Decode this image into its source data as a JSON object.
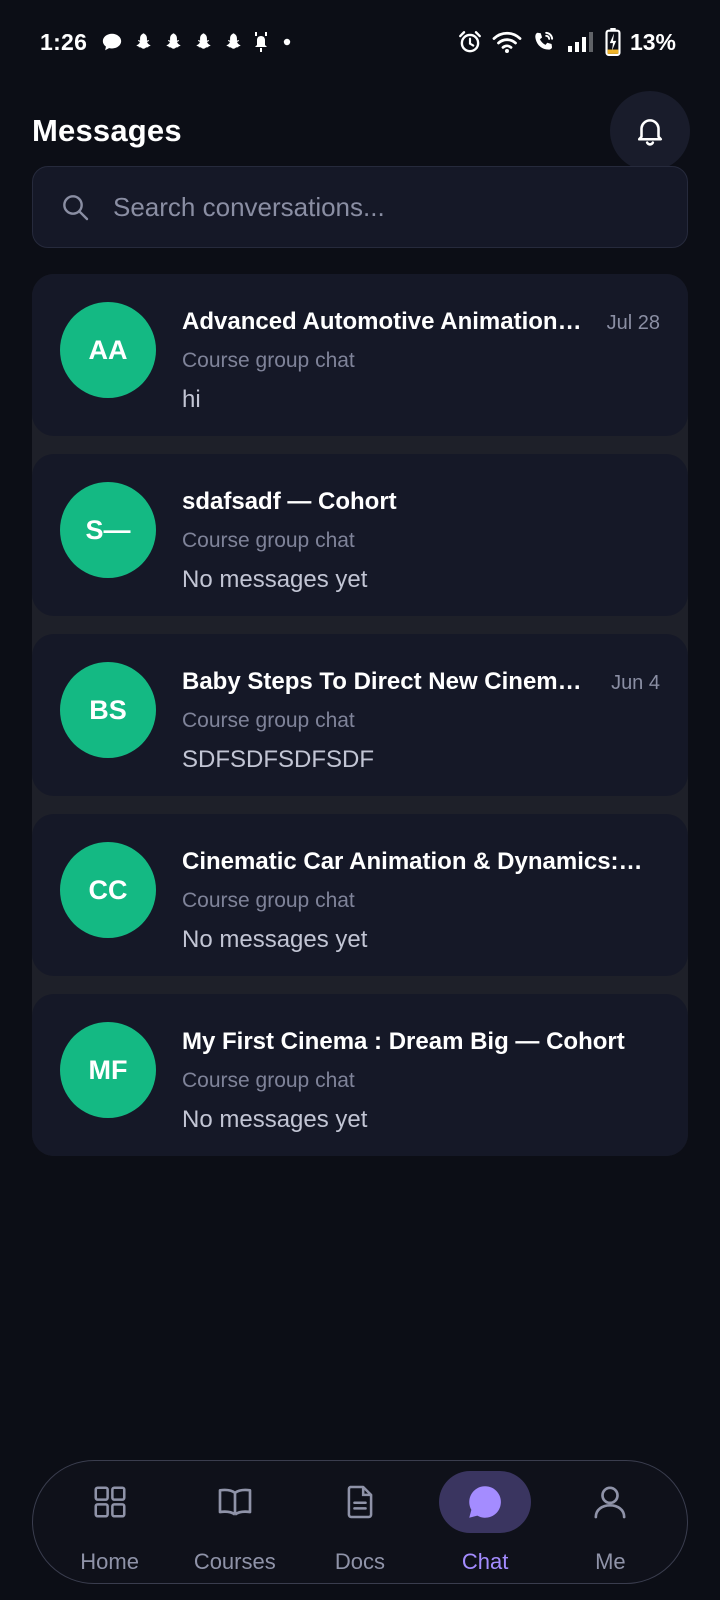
{
  "status_bar": {
    "time": "1:26",
    "battery": "13%",
    "notification_icons": [
      "chat-bubble-icon",
      "snapchat-icon",
      "snapchat-icon",
      "snapchat-icon",
      "snapchat-icon",
      "app-notification-icon",
      "dot-icon"
    ],
    "system_icons": [
      "alarm-icon",
      "wifi-icon",
      "wifi-calling-icon",
      "signal-icon",
      "battery-charging-icon"
    ]
  },
  "header": {
    "title": "Messages",
    "notification_icon": "bell-icon"
  },
  "search": {
    "placeholder": "Search conversations..."
  },
  "conversations": [
    {
      "initials": "AA",
      "title": "Advanced Automotive Animation…",
      "date": "Jul 28",
      "subtitle": "Course group chat",
      "preview": "hi"
    },
    {
      "initials": "S—",
      "title": "sdafsadf — Cohort",
      "date": "",
      "subtitle": "Course group chat",
      "preview": "No messages yet"
    },
    {
      "initials": "BS",
      "title": "Baby Steps To Direct New Cinem…",
      "date": "Jun 4",
      "subtitle": "Course group chat",
      "preview": "SDFSDFSDFSDF"
    },
    {
      "initials": "CC",
      "title": "Cinematic Car Animation & Dynamics:…",
      "date": "",
      "subtitle": "Course group chat",
      "preview": "No messages yet"
    },
    {
      "initials": "MF",
      "title": "My First Cinema : Dream Big  — Cohort",
      "date": "",
      "subtitle": "Course group chat",
      "preview": "No messages yet"
    }
  ],
  "bottom_nav": {
    "items": [
      {
        "label": "Home",
        "icon": "grid-icon",
        "active": false
      },
      {
        "label": "Courses",
        "icon": "book-icon",
        "active": false
      },
      {
        "label": "Docs",
        "icon": "document-icon",
        "active": false
      },
      {
        "label": "Chat",
        "icon": "chat-bubble-icon",
        "active": true
      },
      {
        "label": "Me",
        "icon": "user-icon",
        "active": false
      }
    ]
  },
  "colors": {
    "background": "#0c0e16",
    "card": "#151827",
    "avatar": "#14b983",
    "accent": "#a48cff",
    "active_pill": "#3a3560"
  }
}
